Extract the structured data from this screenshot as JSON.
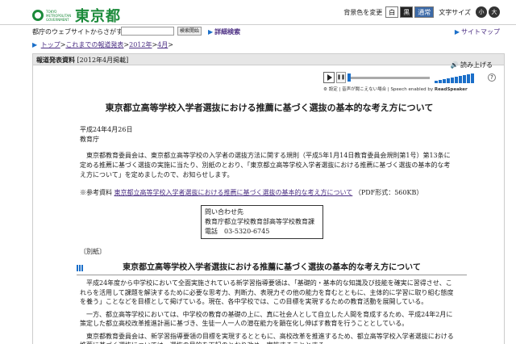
{
  "header": {
    "logo_en": "TOKYO METROPOLITAN GOVERNMENT",
    "logo_jp": "東京都",
    "bg_color_label": "背景色を変更",
    "bg_white": "白",
    "bg_black": "黒",
    "bg_normal": "通常",
    "font_size_label": "文字サイズ",
    "size_small": "小",
    "size_large": "大"
  },
  "search": {
    "label": "都庁のウェブサイトからさがす",
    "value": "",
    "button": "検索開始",
    "advanced": "詳細検索",
    "sitemap": "サイトマップ"
  },
  "breadcrumb": {
    "items": [
      "トップ",
      "これまでの報道発表",
      "2012年",
      "4月"
    ],
    "separator": ">"
  },
  "release": {
    "label": "報道発表資料",
    "date": "[2012年4月掲載]"
  },
  "readspeaker": {
    "link": "読み上げる",
    "settings": "設定",
    "help_text": "音声が聞こえない場合",
    "powered": "Speech enabled by",
    "brand": "ReadSpeaker",
    "help_icon": "?"
  },
  "content": {
    "title": "東京都立高等学校入学者選抜における推薦に基づく選抜の基本的な考え方について",
    "date": "平成24年4月26日",
    "dept": "教育庁",
    "para1": "東京都教育委員会は、東京都立高等学校の入学者の選抜方法に関する規則（平成5年1月14日教育委員会規則第1号）第13条に定める推薦に基づく選抜の実施に当たり、別紙のとおり、「東京都立高等学校入学者選抜における推薦に基づく選抜の基本的な考え方について」を定めましたので、お知らせします。",
    "ref_label": "※参考資料",
    "ref_link": "東京都立高等学校入学者選抜における推薦に基づく選抜の基本的な考え方について",
    "ref_format": "（PDF形式：560KB）",
    "contact": [
      "問い合わせ先",
      "教育庁都立学校教育部高等学校教育課",
      "電話　03-5320-6745"
    ],
    "appendix": "〔別紙〕",
    "sub_title": "東京都立高等学校入学者選抜における推薦に基づく選抜の基本的な考え方について",
    "body1": "平成24年度から中学校において全面実施されている新学習指導要領は、「基礎的・基本的な知識及び技能を確実に習得させ、これらを活用して課題を解決するために必要な思考力、判断力、表現力その他の能力を育むとともに、主体的に学習に取り組む態度を養う」ことなどを目標として掲げている。現在、各中学校では、この目標を実現するための教育活動を展開している。",
    "body2": "一方、都立高等学校においては、中学校の教育の基礎の上に、真に社会人として自立した人間を育成するため、平成24年2月に策定した都立高校改革推進計画に基づき、生徒一人一人の潜在能力を顕在化し伸ばす教育を行うこととしている。",
    "body3": "東京都教育委員会は、新学習指導要領の目標を実現するとともに、高校改革を推進するため、都立高等学校入学者選抜における推薦に基づく選抜については、選抜の目的を下記のとおり改め、実施することとする。"
  },
  "colors": {
    "brand_green": "#1b8a3a",
    "link_purple": "#4b2e83",
    "accent_blue": "#1b6fc9"
  }
}
